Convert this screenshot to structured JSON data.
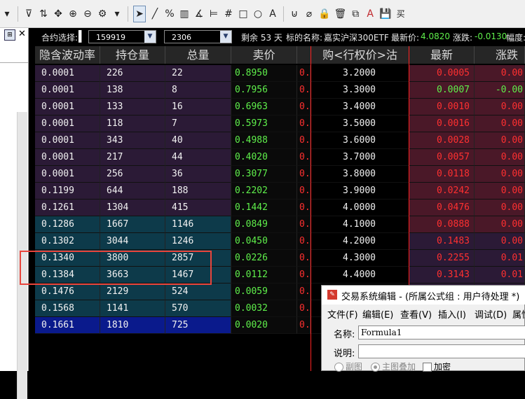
{
  "toolbar": {
    "icons": [
      "dropdown-arrow",
      "filter-settings-icon",
      "layout-icon",
      "move-icon",
      "zoom-in-icon",
      "zoom-out-icon",
      "gear-icon",
      "dropdown-arrow",
      "cursor-icon",
      "line-icon",
      "percent-icon",
      "ruler-icon",
      "angle-icon",
      "parallel-lines-icon",
      "grid-icon",
      "rectangle-icon",
      "circle-icon",
      "text-icon",
      "magnet-icon",
      "eraser-icon",
      "lock-icon",
      "delete-icon",
      "copy-icon",
      "font-color-icon",
      "save-icon",
      "buy-icon"
    ],
    "glyphs": [
      "▾",
      "⊽",
      "⇅",
      "✥",
      "⊕",
      "⊖",
      "⚙",
      "▾",
      "➤",
      "╱",
      "%",
      "▥",
      "∡",
      "⊨",
      "#",
      "□",
      "○",
      "A",
      "⊍",
      "⌀",
      "🔒",
      "🗑",
      "⧉",
      "A",
      "💾",
      "买"
    ]
  },
  "info": {
    "contract_label": "合约选择:",
    "contract_code": "159919",
    "month": "2306",
    "remaining_days": "剩余 53 天",
    "underlying_label": "标的名称:",
    "underlying_name": "嘉实沪深300ETF",
    "latest_label": "最新价:",
    "latest_price": "4.0820",
    "change_label": "涨跌:",
    "change_value": "-0.0130",
    "amplitude_label": "幅度:"
  },
  "table": {
    "headers": {
      "iv": "隐含波动率",
      "oi": "持仓量",
      "vol": "总量",
      "sell": "卖价",
      "strike": "购<行权价>沽",
      "latest": "最新",
      "change": "涨跌"
    },
    "rows": [
      {
        "iv": "0.0001",
        "oi": "226",
        "vol": "22",
        "sell": "0.8950",
        "red": "0.",
        "strike": "3.2000",
        "latest": "0.0005",
        "change": "0.00",
        "latest_color": "red",
        "change_color": "red",
        "bg": "#2b1a36",
        "rbg": "#4a1828"
      },
      {
        "iv": "0.0001",
        "oi": "138",
        "vol": "8",
        "sell": "0.7956",
        "red": "0.",
        "strike": "3.3000",
        "latest": "0.0007",
        "change": "-0.00",
        "latest_color": "green",
        "change_color": "green",
        "bg": "#2b1a36",
        "rbg": "#4a1828"
      },
      {
        "iv": "0.0001",
        "oi": "133",
        "vol": "16",
        "sell": "0.6963",
        "red": "0.",
        "strike": "3.4000",
        "latest": "0.0010",
        "change": "0.00",
        "latest_color": "red",
        "change_color": "red",
        "bg": "#2b1a36",
        "rbg": "#4a1828"
      },
      {
        "iv": "0.0001",
        "oi": "118",
        "vol": "7",
        "sell": "0.5973",
        "red": "0.",
        "strike": "3.5000",
        "latest": "0.0016",
        "change": "0.00",
        "latest_color": "red",
        "change_color": "red",
        "bg": "#2b1a36",
        "rbg": "#4a1828"
      },
      {
        "iv": "0.0001",
        "oi": "343",
        "vol": "40",
        "sell": "0.4988",
        "red": "0.",
        "strike": "3.6000",
        "latest": "0.0028",
        "change": "0.00",
        "latest_color": "red",
        "change_color": "red",
        "bg": "#2b1a36",
        "rbg": "#4a1828"
      },
      {
        "iv": "0.0001",
        "oi": "217",
        "vol": "44",
        "sell": "0.4020",
        "red": "0.",
        "strike": "3.7000",
        "latest": "0.0057",
        "change": "0.00",
        "latest_color": "red",
        "change_color": "red",
        "bg": "#2b1a36",
        "rbg": "#4a1828"
      },
      {
        "iv": "0.0001",
        "oi": "256",
        "vol": "36",
        "sell": "0.3077",
        "red": "0.",
        "strike": "3.8000",
        "latest": "0.0118",
        "change": "0.00",
        "latest_color": "red",
        "change_color": "red",
        "bg": "#2b1a36",
        "rbg": "#4a1828"
      },
      {
        "iv": "0.1199",
        "oi": "644",
        "vol": "188",
        "sell": "0.2202",
        "red": "0.",
        "strike": "3.9000",
        "latest": "0.0242",
        "change": "0.00",
        "latest_color": "red",
        "change_color": "red",
        "bg": "#2b1a36",
        "rbg": "#4a1828"
      },
      {
        "iv": "0.1261",
        "oi": "1304",
        "vol": "415",
        "sell": "0.1442",
        "red": "0.",
        "strike": "4.0000",
        "latest": "0.0476",
        "change": "0.00",
        "latest_color": "red",
        "change_color": "red",
        "bg": "#2b1a36",
        "rbg": "#4a1828"
      },
      {
        "iv": "0.1286",
        "oi": "1667",
        "vol": "1146",
        "sell": "0.0849",
        "red": "0.",
        "strike": "4.1000",
        "latest": "0.0888",
        "change": "0.00",
        "latest_color": "red",
        "change_color": "red",
        "bg": "#0d3a4a",
        "rbg": "#4a1828"
      },
      {
        "iv": "0.1302",
        "oi": "3044",
        "vol": "1246",
        "sell": "0.0450",
        "red": "0.",
        "strike": "4.2000",
        "latest": "0.1483",
        "change": "0.00",
        "latest_color": "red",
        "change_color": "red",
        "bg": "#0d3a4a",
        "rbg": "#2b1a36"
      },
      {
        "iv": "0.1340",
        "oi": "3800",
        "vol": "2857",
        "sell": "0.0226",
        "red": "0.",
        "strike": "4.3000",
        "latest": "0.2255",
        "change": "0.01",
        "latest_color": "red",
        "change_color": "red",
        "bg": "#0d3a4a",
        "rbg": "#2b1a36"
      },
      {
        "iv": "0.1384",
        "oi": "3663",
        "vol": "1467",
        "sell": "0.0112",
        "red": "0.",
        "strike": "4.4000",
        "latest": "0.3143",
        "change": "0.01",
        "latest_color": "red",
        "change_color": "red",
        "bg": "#0d3a4a",
        "rbg": "#2b1a36"
      },
      {
        "iv": "0.1476",
        "oi": "2129",
        "vol": "524",
        "sell": "0.0059",
        "red": "0.",
        "strike": "",
        "latest": "",
        "change": "",
        "latest_color": "red",
        "change_color": "red",
        "bg": "#0d3a4a",
        "rbg": "#2b1a36"
      },
      {
        "iv": "0.1568",
        "oi": "1141",
        "vol": "570",
        "sell": "0.0032",
        "red": "0.",
        "strike": "",
        "latest": "",
        "change": "",
        "latest_color": "red",
        "change_color": "red",
        "bg": "#0d3a4a",
        "rbg": "#2b1a36"
      },
      {
        "iv": "0.1661",
        "oi": "1810",
        "vol": "725",
        "sell": "0.0020",
        "red": "0.",
        "strike": "",
        "latest": "",
        "change": "",
        "latest_color": "red",
        "change_color": "red",
        "bg": "#0a1a8c",
        "rbg": "#2b1a36"
      }
    ]
  },
  "dialog": {
    "title": "交易系统编辑 - (所属公式组 : 用户待处理 *)",
    "menu": [
      "文件(F)",
      "编辑(E)",
      "查看(V)",
      "插入(I)",
      "调试(D)",
      "属性"
    ],
    "name_label": "名称:",
    "name_value": "Formula1",
    "desc_label": "说明:",
    "desc_value": "",
    "opt_subchart": "副图",
    "opt_main_overlay": "主图叠加",
    "opt_encrypt": "加密"
  },
  "colors": {
    "sell_green": "#5ff04b",
    "up_red": "#ff3030",
    "highlight_box": "#e8453c",
    "selected_row": "#0a1a8c"
  }
}
